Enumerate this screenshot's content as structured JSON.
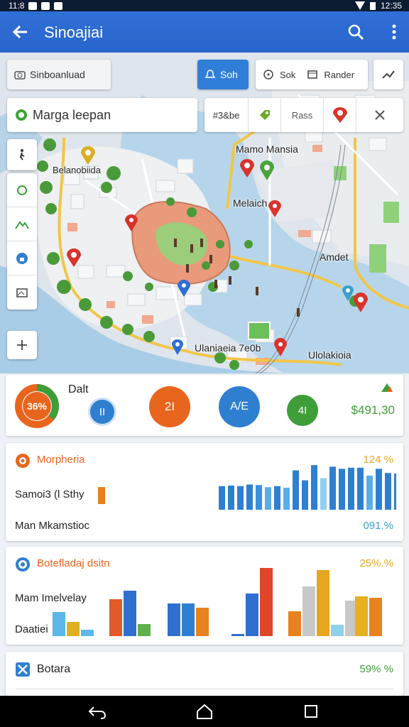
{
  "status_bar": {
    "left_text": "11:8",
    "time": "12:35"
  },
  "app_bar": {
    "title": "Sinoajiai",
    "back_icon": "arrow-left-icon",
    "search_icon": "search-icon",
    "more_icon": "more-vert-icon"
  },
  "map_toolbar": {
    "location_chip": "Sinboanluad",
    "sort_button": "Soh",
    "sort_option": "Sok",
    "render_option": "Rander"
  },
  "search_bar": {
    "query": "Marga leepan",
    "tab_stats": "#3&be",
    "tab_pass": "Rass"
  },
  "map_labels": {
    "north_district": "Mamo Mansia",
    "west_district": "Belanobiida",
    "center": "Melaich",
    "east": "Amdet",
    "south": "Ulaniaeia 7e0b",
    "southeast": "Ulolakioia"
  },
  "colors": {
    "primary": "#2f6fd6",
    "accent_blue": "#2f7fd0",
    "orange": "#e8651e",
    "green": "#3f9d3a",
    "red": "#d8332c",
    "yellow": "#e6b020"
  },
  "summary": {
    "donut_label": "36%",
    "title": "Dalt",
    "metric_a": "II",
    "metric_b": "2I",
    "metric_c": "A/E",
    "metric_d": "4I",
    "total": "$491,30",
    "donut_fraction": 0.36
  },
  "panel1": {
    "title": "Morpheria",
    "percent_top": "124 %",
    "row1_label": "Samoi3 (l Sthy",
    "row2_label": "Man Mkamstioc",
    "percent_bottom": "091.%",
    "chart_data": {
      "type": "bar",
      "series": [
        {
          "values": [
            0.45,
            0.46,
            0.45,
            0.48,
            0.47,
            0.43,
            0.45,
            0.42,
            0.75,
            0.56,
            0.85,
            0.6,
            0.82,
            0.78,
            0.8,
            0.8,
            0.65,
            0.78,
            0.7,
            0.69
          ]
        }
      ]
    }
  },
  "panel2": {
    "title": "Botefladaj dsitn",
    "percent": "25%.%",
    "row1_label": "Mam Imelvelay",
    "row2_label": "Daatiei",
    "chart_data": {
      "type": "bar",
      "groups": [
        {
          "values": [
            0.34,
            0.2,
            0.09
          ],
          "colors": [
            "#5bb8e8",
            "#e0b020",
            "#5bb8e8"
          ]
        },
        {
          "values": [
            0.52,
            0.64,
            0.17
          ],
          "colors": [
            "#e35a2a",
            "#2f6fd0",
            "#5fb04a"
          ]
        },
        {
          "values": [
            0.46,
            0.46,
            0.4
          ],
          "colors": [
            "#2f6fd0",
            "#2f7fd0",
            "#e8821e"
          ]
        },
        {
          "values": [
            0.03,
            0.6,
            0.96
          ],
          "colors": [
            "#2f6fd0",
            "#2f6fd0",
            "#e0452a"
          ]
        },
        {
          "values": [
            0.35,
            0.7,
            0.93
          ],
          "colors": [
            "#e8821e",
            "#c8c8c8",
            "#e8a520"
          ]
        },
        {
          "values": [
            0.08,
            0.16,
            0.5
          ],
          "colors": [
            "#e8a520",
            "#8fd0ec",
            "#c8c8c8"
          ]
        },
        {
          "values": [
            0.56,
            0.54
          ],
          "colors": [
            "#e8b020",
            "#e8821e"
          ]
        }
      ]
    }
  },
  "panel3": {
    "title": "Botara",
    "percent": "59% %"
  }
}
